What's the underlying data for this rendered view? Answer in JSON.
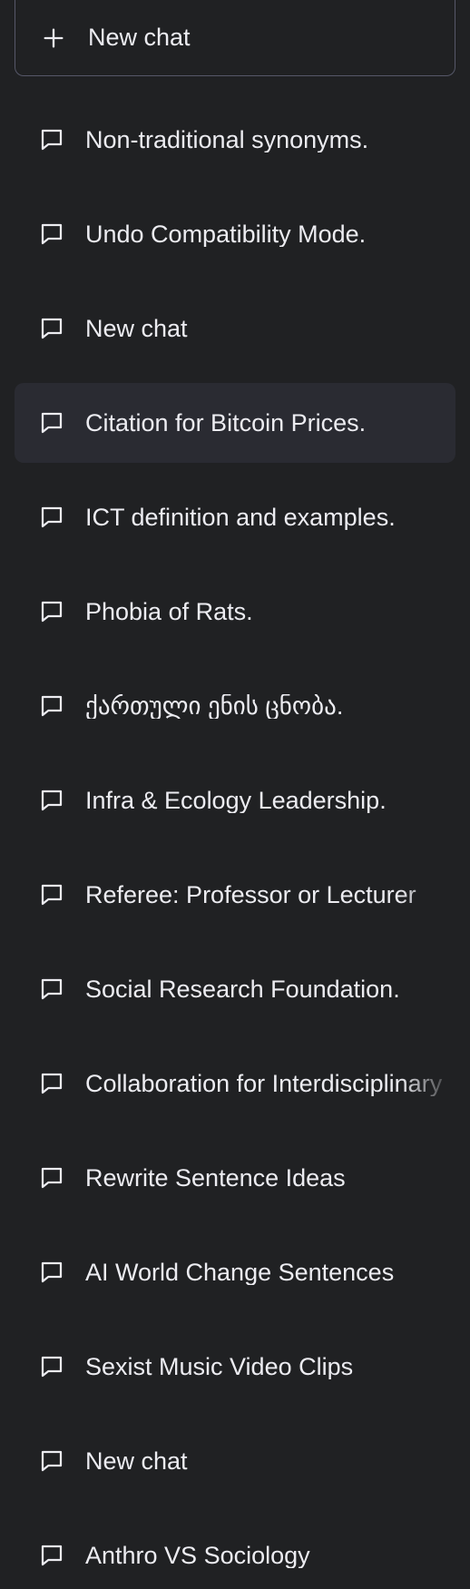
{
  "new_chat": {
    "label": "New chat",
    "icon": "plus-icon"
  },
  "conversations": [
    {
      "title": "Non-traditional synonyms.",
      "icon": "chat-bubble-icon"
    },
    {
      "title": "Undo Compatibility Mode.",
      "icon": "chat-bubble-icon"
    },
    {
      "title": "New chat",
      "icon": "chat-bubble-icon"
    },
    {
      "title": "Citation for Bitcoin Prices.",
      "icon": "chat-bubble-icon",
      "active": true
    },
    {
      "title": "ICT definition and examples.",
      "icon": "chat-bubble-icon"
    },
    {
      "title": "Phobia of Rats.",
      "icon": "chat-bubble-icon"
    },
    {
      "title": "ქართული ენის ცნობა.",
      "icon": "chat-bubble-icon"
    },
    {
      "title": "Infra & Ecology Leadership.",
      "icon": "chat-bubble-icon"
    },
    {
      "title": "Referee: Professor or Lecturer",
      "icon": "chat-bubble-icon"
    },
    {
      "title": "Social Research Foundation.",
      "icon": "chat-bubble-icon"
    },
    {
      "title": "Collaboration for Interdisciplinary",
      "icon": "chat-bubble-icon"
    },
    {
      "title": "Rewrite Sentence Ideas",
      "icon": "chat-bubble-icon"
    },
    {
      "title": "AI World Change Sentences",
      "icon": "chat-bubble-icon"
    },
    {
      "title": "Sexist Music Video Clips",
      "icon": "chat-bubble-icon"
    },
    {
      "title": "New chat",
      "icon": "chat-bubble-icon"
    },
    {
      "title": "Anthro VS Sociology",
      "icon": "chat-bubble-icon"
    }
  ],
  "colors": {
    "background": "#202123",
    "active_item": "#2a2b32",
    "text": "#ececf1",
    "border": "#565869"
  }
}
